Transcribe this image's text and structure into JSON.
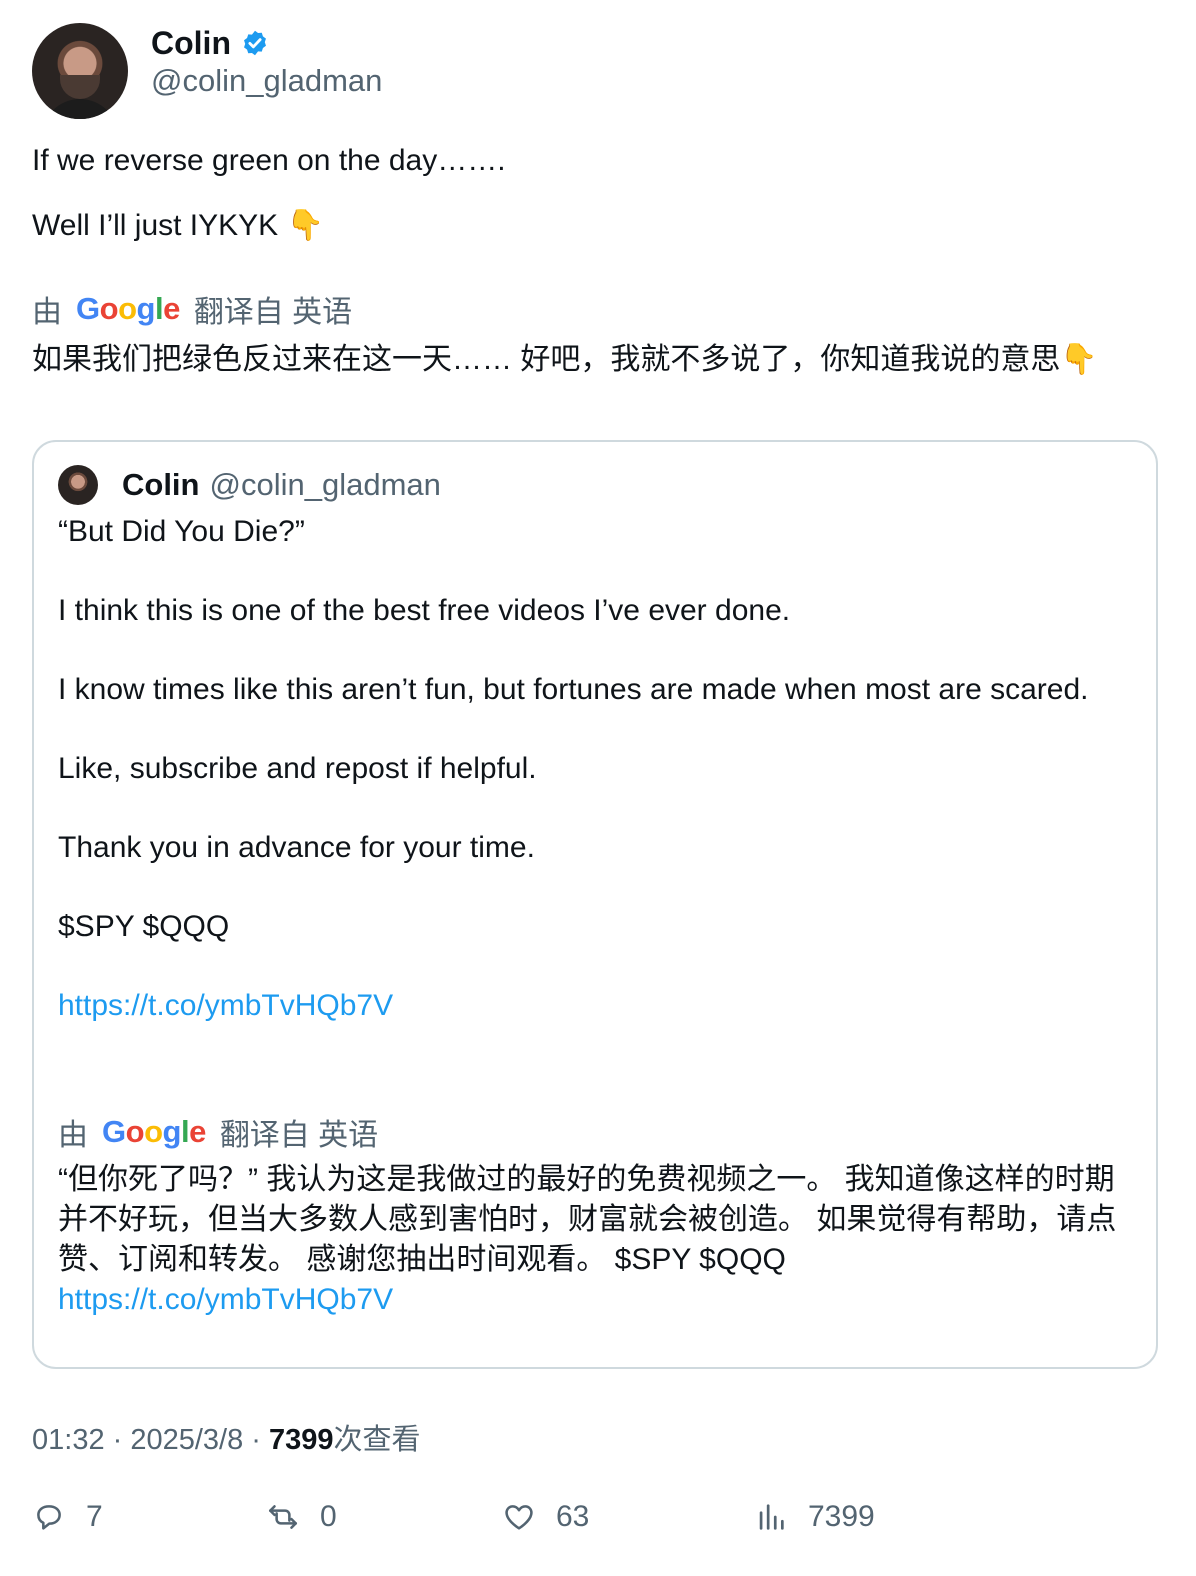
{
  "author": {
    "name": "Colin",
    "handle": "@colin_gladman"
  },
  "tweet": {
    "line1": "If we reverse green on the day…….",
    "line2": "Well I’ll just IYKYK 👇"
  },
  "translation": {
    "by": "由",
    "google": [
      "G",
      "o",
      "o",
      "g",
      "l",
      "e"
    ],
    "from": "翻译自 英语",
    "text": "如果我们把绿色反过来在这一天…… 好吧，我就不多说了，你知道我说的意思👇"
  },
  "quote": {
    "name": "Colin",
    "handle": "@colin_gladman",
    "paragraphs": [
      "“But Did You Die?”",
      "I think this is one of the best free videos I’ve ever done.",
      "I know times like this aren’t fun, but fortunes are made when most are scared.",
      "Like, subscribe and repost if helpful.",
      "Thank you in advance for your time.",
      "$SPY $QQQ"
    ],
    "link": "https://t.co/ymbTvHQb7V",
    "translation": {
      "by": "由",
      "from": "翻译自 英语",
      "text": "“但你死了吗？” 我认为这是我做过的最好的免费视频之一。 我知道像这样的时期并不好玩，但当大多数人感到害怕时，财富就会被创造。 如果觉得有帮助，请点赞、订阅和转发。 感谢您抽出时间观看。 $SPY $QQQ",
      "link": "https://t.co/ymbTvHQb7V"
    }
  },
  "meta": {
    "time": "01:32",
    "sep1": " · ",
    "date": "2025/3/8",
    "sep2": " · ",
    "views": "7399",
    "views_suffix": "次查看"
  },
  "actions": {
    "replies": "7",
    "reposts": "0",
    "likes": "63",
    "views": "7399"
  },
  "colors": {
    "link": "#1d9bf0",
    "verified": "#1d9bf0",
    "secondary_text": "#536471",
    "border": "#cfd9de"
  }
}
